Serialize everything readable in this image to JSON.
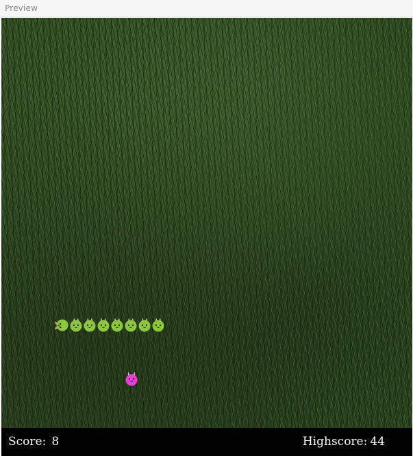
{
  "window": {
    "title": "Preview"
  },
  "game": {
    "snake": {
      "length": 8,
      "direction": "left",
      "head_icon": "snake-head-icon",
      "body_icon": "snake-body-icon",
      "color": "#8cc63f"
    },
    "food": {
      "icon": "bunny-food-icon",
      "color": "#e83ed8"
    }
  },
  "footer": {
    "score_label": "Score:",
    "score_value": "8",
    "highscore_label": "Highscore:",
    "highscore_value": "44"
  }
}
